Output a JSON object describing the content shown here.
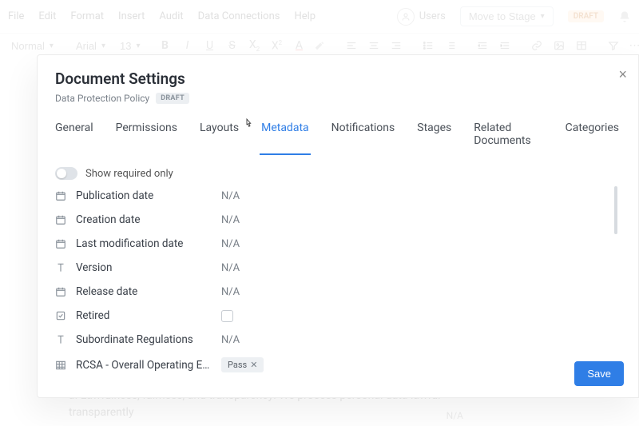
{
  "menubar": {
    "items": [
      "File",
      "Edit",
      "Format",
      "Insert",
      "Audit",
      "Data Connections",
      "Help"
    ],
    "users_label": "Users",
    "move_stage": "Move to Stage",
    "draft_badge": "DRAFT"
  },
  "toolbar": {
    "style": "Normal",
    "font": "Arial",
    "size": "13"
  },
  "background_text": {
    "line_a": "a. Lawfulness, fairness, and transparency: We process personal data lawful",
    "line_b": "transparently",
    "na": "N/A"
  },
  "modal": {
    "title": "Document Settings",
    "subtitle": "Data Protection Policy",
    "draft_chip": "DRAFT",
    "tabs": [
      "General",
      "Permissions",
      "Layouts",
      "Metadata",
      "Notifications",
      "Stages",
      "Related Documents",
      "Categories"
    ],
    "active_tab_index": 3,
    "show_required_only": "Show required only",
    "save": "Save",
    "close": "×",
    "metadata": [
      {
        "icon": "calendar",
        "label": "Publication date",
        "value": "N/A"
      },
      {
        "icon": "calendar",
        "label": "Creation date",
        "value": "N/A"
      },
      {
        "icon": "calendar",
        "label": "Last modification date",
        "value": "N/A"
      },
      {
        "icon": "text",
        "label": "Version",
        "value": "N/A"
      },
      {
        "icon": "calendar",
        "label": "Release date",
        "value": "N/A"
      },
      {
        "icon": "checkbox",
        "label": "Retired",
        "value": "checkbox"
      },
      {
        "icon": "text",
        "label": "Subordinate Regulations",
        "value": "N/A"
      },
      {
        "icon": "table",
        "label": "RCSA - Overall Operating E…",
        "value": "chip",
        "chip": "Pass"
      }
    ]
  }
}
